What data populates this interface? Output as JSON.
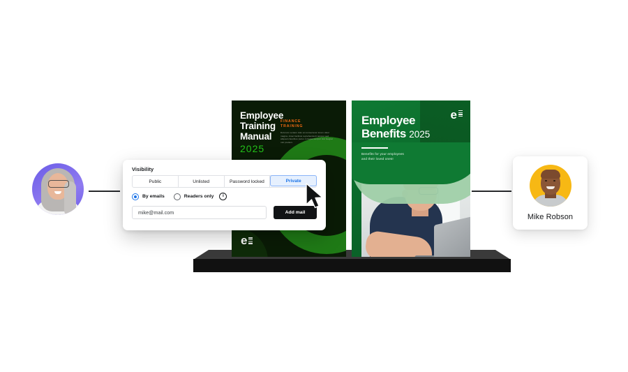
{
  "scene": {
    "left_avatar": {
      "name": "left-user-avatar",
      "bg_color": "#6b5ce7"
    },
    "connector_left": "connector-line",
    "connector_right": "connector-line"
  },
  "modal": {
    "title": "Visibility",
    "segments": [
      {
        "label": "Public",
        "active": false
      },
      {
        "label": "Unlisted",
        "active": false
      },
      {
        "label": "Password locked",
        "active": false
      },
      {
        "label": "Private",
        "active": true
      }
    ],
    "radios": [
      {
        "label": "By emails",
        "selected": true
      },
      {
        "label": "Readers only",
        "selected": false
      }
    ],
    "info_icon": "i",
    "email_value": "mike@mail.com",
    "email_placeholder": "mike@mail.com",
    "add_button": "Add mail",
    "accent_color": "#1a73e8",
    "active_tab_bg": "#e6f0fe"
  },
  "covers": {
    "dark": {
      "title_line1": "Employee Training",
      "title_line2": "Manual",
      "year": "2025",
      "kicker_line1": "FINANCE",
      "kicker_line2": "TRAINING",
      "body": "Dolorum veniam duis at consectetur lorem dolor magna. Amet facilisis reprehenderit tempor sed aliquam faucibus purus in fugiat tempor nisi feugiat nisl pretium.",
      "logo": "e",
      "bg_color": "#0a1b06",
      "accent_green": "#23c21a",
      "accent_orange": "#f06a12"
    },
    "green": {
      "title_line1": "Employee",
      "title_line2": "Benefits",
      "year": "2025",
      "subtitle_line1": "Benefits for your employees",
      "subtitle_line2": "and their loved ones!",
      "logo": "e",
      "bg_color": "#0f7a33"
    }
  },
  "right_card": {
    "name": "Mike Robson",
    "avatar_bg": "#f7b814"
  }
}
